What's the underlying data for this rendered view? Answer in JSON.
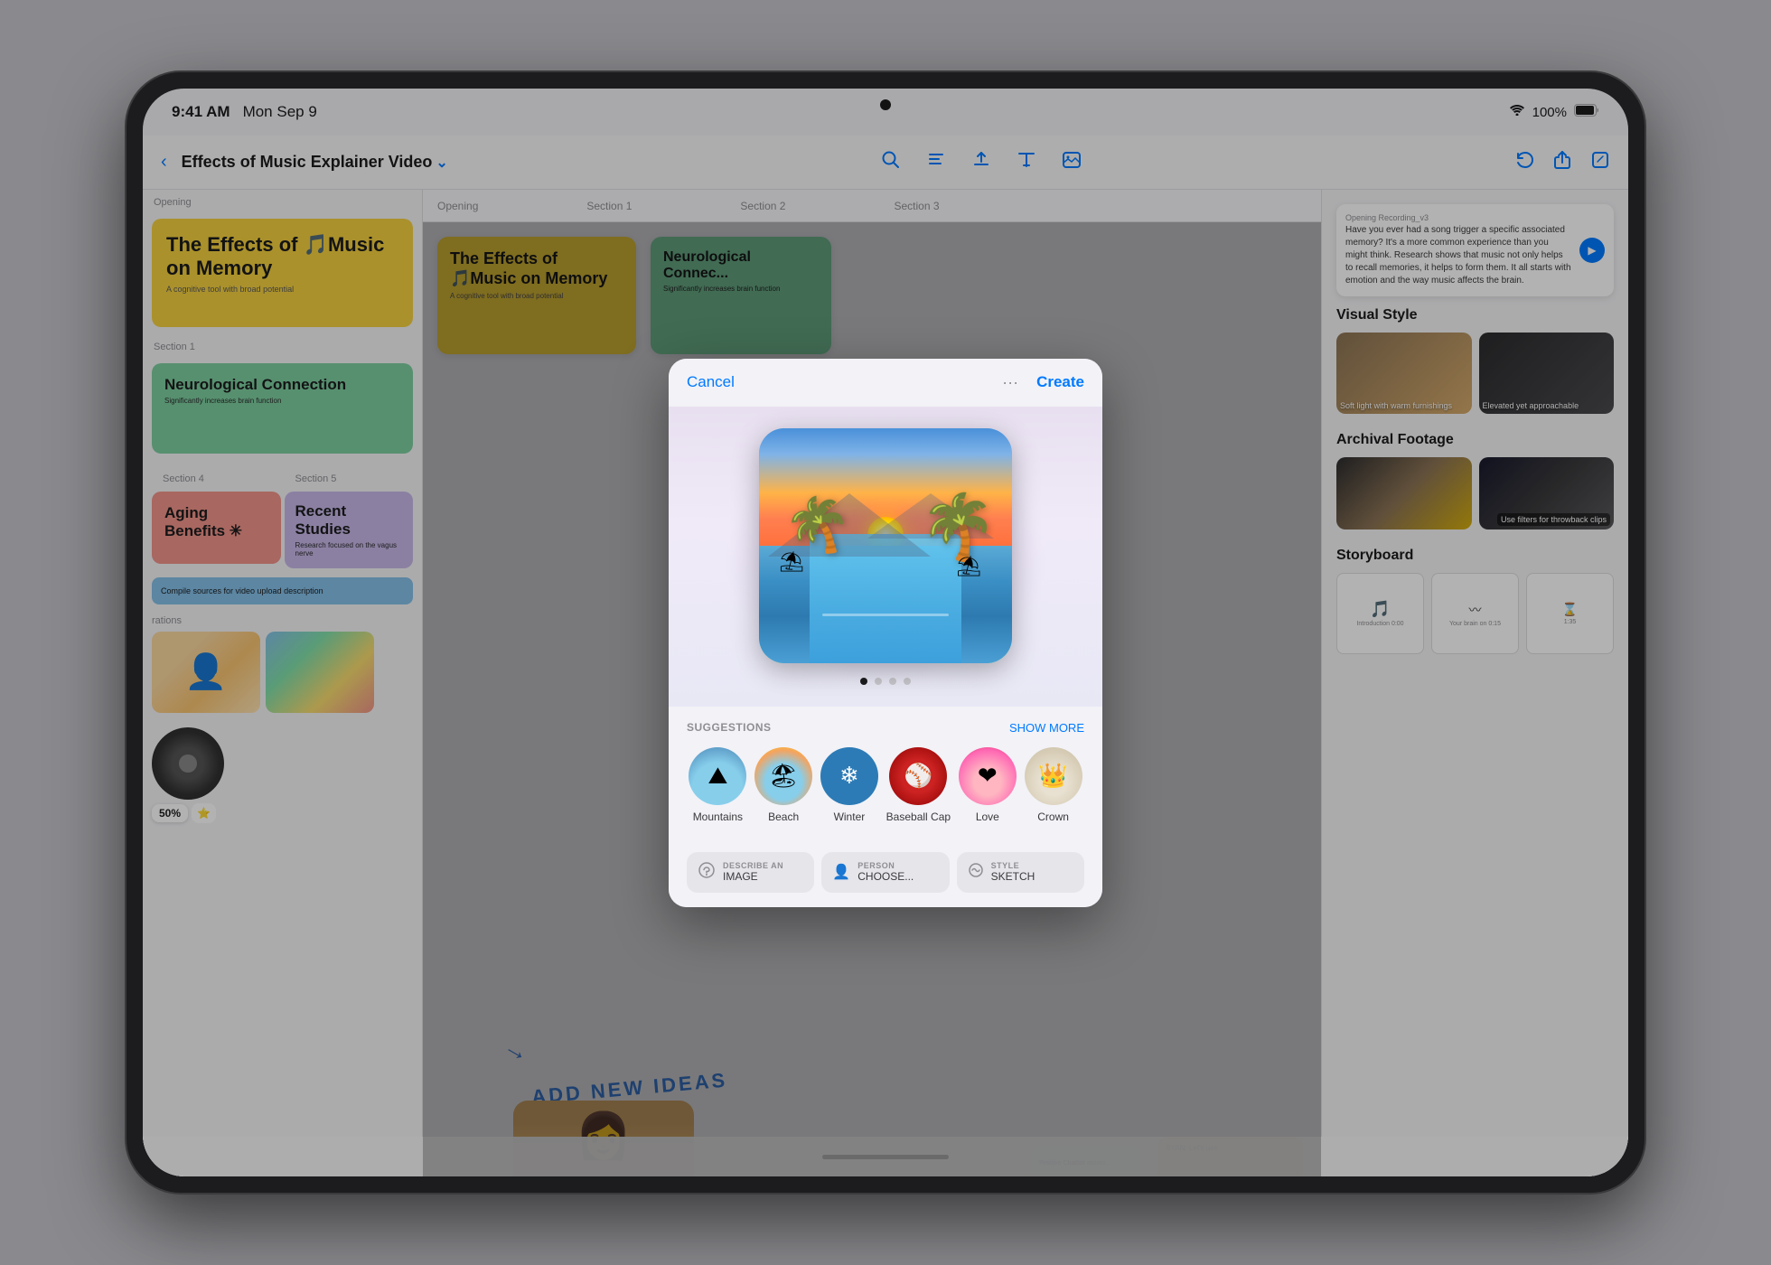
{
  "device": {
    "camera_label": "front camera"
  },
  "status_bar": {
    "time": "9:41 AM",
    "date": "Mon Sep 9",
    "wifi": "WiFi",
    "battery_percent": "100%",
    "battery_full": true
  },
  "toolbar": {
    "back_label": "‹",
    "doc_title": "Effects of Music Explainer Video",
    "chevron": "⌄",
    "icons": [
      "search",
      "document",
      "upload",
      "text",
      "image"
    ],
    "right_icons": [
      "undo",
      "share",
      "edit"
    ],
    "dots": "···"
  },
  "slides": {
    "opening_label": "Opening",
    "section1_label": "Section 1",
    "section2_label": "Section 2",
    "section3_label": "Section 3",
    "section4_label": "Section 4",
    "section5_label": "Section 5",
    "slide1_title": "The Effects of 🎵Music on Memory",
    "slide1_subtitle": "A cognitive tool with broad potential",
    "slide2_title": "Neurological Connection",
    "slide2_subtitle": "Significantly increases brain function",
    "slide3_title": "Aging Benefits ✳",
    "slide4_title": "Recent Studies",
    "slide4_subtitle": "Research focused on the vagus nerve"
  },
  "right_panel": {
    "recording_text": "Have you ever had a song trigger a specific associated memory? It's a more common experience than you might think. Research shows that music not only helps to recall memories, it helps to form them. It all starts with emotion and the way music affects the brain.",
    "recording_label": "Opening Recording_v3",
    "visual_style_title": "Visual Style",
    "thumb1_label": "Soft light with warm furnishings",
    "thumb2_label": "Elevated yet approachable",
    "archival_title": "Archival Footage",
    "archival_note": "Use filters for throwback clips",
    "storyboard_title": "Storyboard",
    "sb1_label": "Introduction 0:00",
    "sb2_label": "Your brain on 0:15"
  },
  "modal": {
    "cancel_label": "Cancel",
    "create_label": "Create",
    "more_icon": "···",
    "dots": [
      {
        "active": true
      },
      {
        "active": false
      },
      {
        "active": false
      },
      {
        "active": false
      }
    ],
    "suggestions_label": "SUGGESTIONS",
    "show_more_label": "SHOW MORE",
    "suggestions": [
      {
        "id": "mountains",
        "label": "Mountains",
        "emoji": "🏔"
      },
      {
        "id": "beach",
        "label": "Beach",
        "emoji": "🏖"
      },
      {
        "id": "winter",
        "label": "Winter",
        "emoji": "❄"
      },
      {
        "id": "baseball-cap",
        "label": "Baseball Cap",
        "emoji": "🧢"
      },
      {
        "id": "love",
        "label": "Love",
        "emoji": "❤"
      },
      {
        "id": "crown",
        "label": "Crown",
        "emoji": "👑"
      }
    ],
    "describe_label": "DESCRIBE AN",
    "describe_sublabel": "IMAGE",
    "person_label": "PERSON",
    "person_sublabel": "CHOOSE...",
    "style_label": "STYLE",
    "style_sublabel": "SKETCH"
  },
  "canvas": {
    "hand_drawn_text": "ADD NEW IDEAS",
    "percentage": "50%",
    "blue_sticky": "Compile sources for video upload description"
  }
}
